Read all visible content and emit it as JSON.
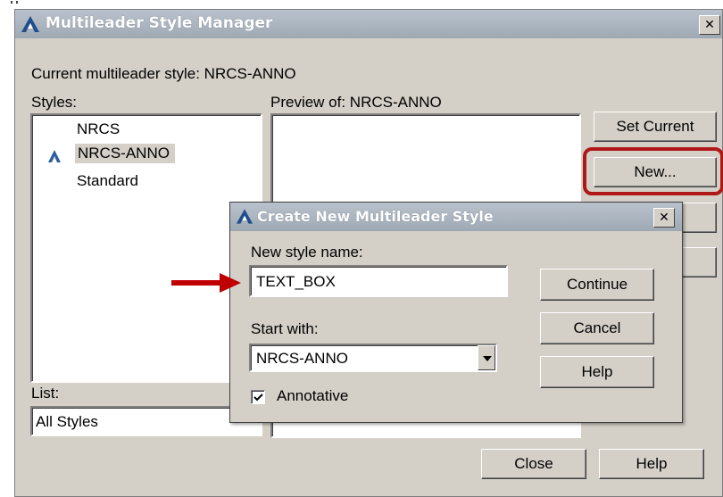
{
  "main_dialog": {
    "title": "Multileader Style Manager",
    "close_glyph": "✕",
    "current_style_label": "Current multileader style: NRCS-ANNO",
    "styles_label": "Styles:",
    "styles": [
      "NRCS",
      "NRCS-ANNO",
      "Standard"
    ],
    "selected_style_index": 1,
    "preview_label": "Preview of: NRCS-ANNO",
    "list_label": "List:",
    "list_value": "All Styles",
    "buttons": {
      "set_current": "Set Current",
      "new": "New...",
      "close": "Close",
      "help": "Help"
    }
  },
  "sub_dialog": {
    "title": "Create New Multileader Style",
    "close_glyph": "✕",
    "new_style_name_label": "New style name:",
    "new_style_name_value": "TEXT_BOX",
    "start_with_label": "Start with:",
    "start_with_value": "NRCS-ANNO",
    "annotative_label": "Annotative",
    "annotative_checked": true,
    "buttons": {
      "continue": "Continue",
      "cancel": "Cancel",
      "help": "Help"
    }
  },
  "annotation_colors": {
    "arrow": "#c00000",
    "highlight": "#b01818"
  },
  "icons": [
    "autocad-app-icon",
    "annotative-style-icon",
    "arrow-annotation-icon",
    "dropdown-arrow-icon",
    "checkmark-icon"
  ]
}
